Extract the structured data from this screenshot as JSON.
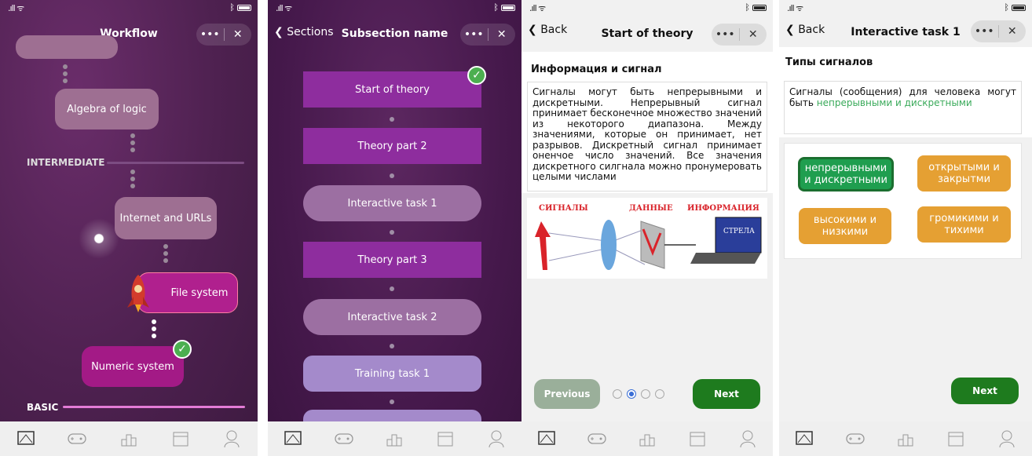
{
  "screen1": {
    "header": {
      "title": "Workflow",
      "more": "•••",
      "close": "✕"
    },
    "nodes": [
      {
        "label": "Algebra of logic"
      },
      {
        "label": "Internet and URLs"
      },
      {
        "label": "File system"
      },
      {
        "label": "Numeric system"
      }
    ],
    "levels": {
      "intermediate": "INTERMEDIATE",
      "basic": "BASIC"
    }
  },
  "screen2": {
    "header": {
      "back": "Sections",
      "title": "Subsection name",
      "more": "•••",
      "close": "✕"
    },
    "items": [
      {
        "label": "Start of theory"
      },
      {
        "label": "Theory part 2"
      },
      {
        "label": "Interactive task 1"
      },
      {
        "label": "Theory part 3"
      },
      {
        "label": "Interactive task 2"
      },
      {
        "label": "Training task 1"
      }
    ]
  },
  "screen3": {
    "header": {
      "back": "Back",
      "title": "Start of theory",
      "more": "•••",
      "close": "✕"
    },
    "heading": "Информация и сигнал",
    "body": "Сигналы могут быть непрерывными и дискретными. Непрерывный сигнал принимает бесконечное множество значений из некоторого диапазона. Между значениями, которые он принимает, нет разрывов. Дискретный сигнал принимает оненчое число значений. Все значения дискретного силгнала можно пронумеровать целыми числами",
    "image_labels": {
      "signals": "СИГНАЛЫ",
      "data": "ДАННЫЕ",
      "info": "ИНФОРМАЦИЯ",
      "screen": "СТРЕЛА"
    },
    "prev": "Previous",
    "next": "Next",
    "page_current": 2,
    "page_total": 4
  },
  "screen4": {
    "header": {
      "back": "Back",
      "title": "Interactive task 1",
      "more": "•••",
      "close": "✕"
    },
    "heading": "Типы сигналов",
    "question_plain": "Сигналы (сообщения) для человека могут быть ",
    "question_answer": "непрерывными и дискретными",
    "options": [
      {
        "label": "непрерывными и дискретными",
        "selected": true
      },
      {
        "label": "открытыми и закрытми",
        "selected": false
      },
      {
        "label": "высокими и низкими",
        "selected": false
      },
      {
        "label": "громикими и тихими",
        "selected": false
      }
    ],
    "next": "Next"
  },
  "colors": {
    "green": "#1e7b1e",
    "orange": "#e5a033",
    "purple": "#8e2d9e",
    "answer_green": "#3aaa5a"
  }
}
